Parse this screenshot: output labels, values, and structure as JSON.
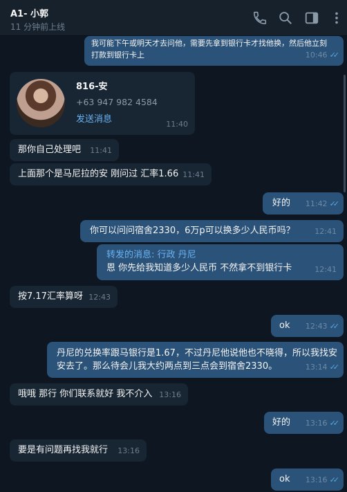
{
  "header": {
    "title": "A1- 小郭",
    "status": "11 分钟前上线"
  },
  "messages": [
    {
      "dir": "out",
      "lines": [
        "我可能下午或明天才去问他，需要先拿到银行卡才找他换，然后他立刻",
        "打款到银行卡上"
      ],
      "time": "10:46"
    },
    {
      "dir": "in",
      "type": "contact",
      "name": "816-安",
      "phone": "+63 947 982 4584",
      "action": "发送消息",
      "time": "11:40"
    },
    {
      "dir": "in",
      "text": "那你自己处理吧",
      "time": "11:41"
    },
    {
      "dir": "in",
      "text": "上面那个是马尼拉的安 刚问过 汇率1.66",
      "time": "11:41"
    },
    {
      "dir": "out",
      "text": "好的",
      "time": "11:42"
    },
    {
      "dir": "out",
      "text": "你可以问问宿舍2330，6万p可以换多少人民币吗？",
      "time": "12:41"
    },
    {
      "dir": "out",
      "type": "forward",
      "fwd_title": "转发的消息: 行政 丹尼",
      "text": "恩 你先给我知道多少人民币 不然拿不到银行卡",
      "time": "12:41"
    },
    {
      "dir": "in",
      "text": "按7.17汇率算呀",
      "time": "12:43"
    },
    {
      "dir": "out",
      "text": "ok",
      "time": "12:43"
    },
    {
      "dir": "out",
      "lines": [
        "丹尼的兑换率跟马银行是1.67，不过丹尼他说他也不晓得，所以我找安",
        "安去了。那么待会儿我大约两点到三点会到宿舍2330。"
      ],
      "time": "13:14"
    },
    {
      "dir": "in",
      "text": "哦哦 那行 你们联系就好 我不介入",
      "time": "13:16"
    },
    {
      "dir": "out",
      "text": "好的",
      "time": "13:16"
    },
    {
      "dir": "in",
      "text": "要是有问题再找我就行",
      "time": "13:16"
    },
    {
      "dir": "out",
      "text": "ok",
      "time": "13:16"
    }
  ],
  "icons": {
    "call": "phone-icon",
    "search": "search-icon",
    "sidebar": "sidebar-toggle-icon",
    "menu": "more-vertical-icon",
    "read": "double-check-icon"
  },
  "colors": {
    "background": "#0e1621",
    "header": "#17212b",
    "incoming": "#182533",
    "outgoing": "#2b5278",
    "link": "#6ab3f3"
  }
}
